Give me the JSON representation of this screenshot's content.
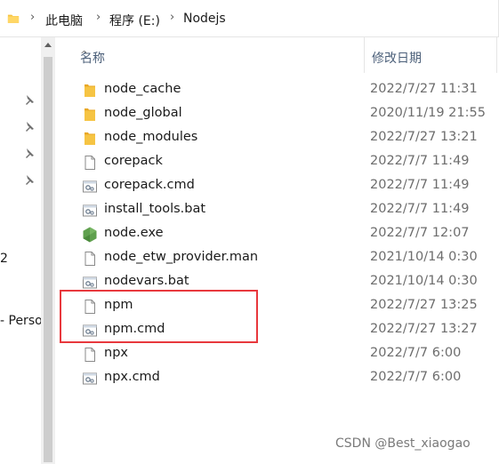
{
  "breadcrumb": [
    "此电脑",
    "程序 (E:)",
    "Nodejs"
  ],
  "columns": {
    "name": "名称",
    "date": "修改日期"
  },
  "nav_partial": [
    "2",
    "- Perso"
  ],
  "files": [
    {
      "name": "node_cache",
      "date": "2022/7/27 11:31",
      "icon": "folder-icon"
    },
    {
      "name": "node_global",
      "date": "2020/11/19 21:55",
      "icon": "folder-icon"
    },
    {
      "name": "node_modules",
      "date": "2022/7/27 13:21",
      "icon": "folder-icon"
    },
    {
      "name": "corepack",
      "date": "2022/7/7 11:49",
      "icon": "file-icon"
    },
    {
      "name": "corepack.cmd",
      "date": "2022/7/7 11:49",
      "icon": "gear-file-icon"
    },
    {
      "name": "install_tools.bat",
      "date": "2022/7/7 11:49",
      "icon": "gear-file-icon"
    },
    {
      "name": "node.exe",
      "date": "2022/7/7 12:07",
      "icon": "nodejs-hexagon-icon"
    },
    {
      "name": "node_etw_provider.man",
      "date": "2021/10/14 0:30",
      "icon": "file-icon"
    },
    {
      "name": "nodevars.bat",
      "date": "2021/10/14 0:30",
      "icon": "gear-file-icon"
    },
    {
      "name": "npm",
      "date": "2022/7/27 13:25",
      "icon": "file-icon"
    },
    {
      "name": "npm.cmd",
      "date": "2022/7/27 13:27",
      "icon": "gear-file-icon"
    },
    {
      "name": "npx",
      "date": "2022/7/7 6:00",
      "icon": "file-icon"
    },
    {
      "name": "npx.cmd",
      "date": "2022/7/7 6:00",
      "icon": "gear-file-icon"
    }
  ],
  "watermark": "CSDN @Best_xiaogao",
  "colors": {
    "folder": "#f6c443",
    "highlight": "#e8383d",
    "header_text": "#4c607a",
    "date_text": "#6d6d6d",
    "node_green": "#5fa04e"
  }
}
